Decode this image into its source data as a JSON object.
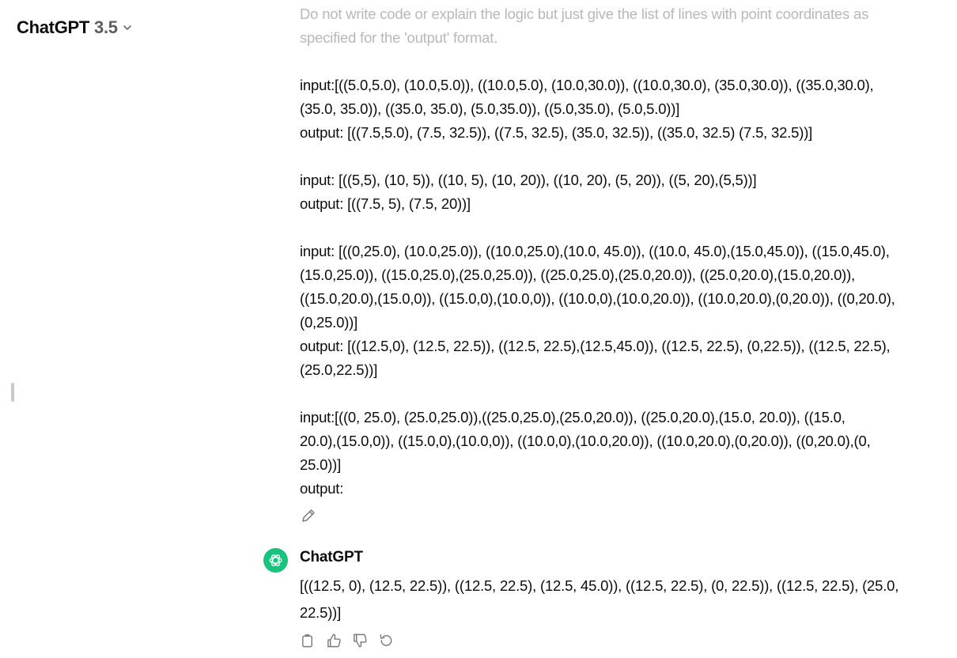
{
  "header": {
    "model_name": "ChatGPT",
    "model_version": "3.5",
    "chevron_icon": "chevron-down-icon"
  },
  "conversation": {
    "user_message": {
      "intro": "Do not write code or explain the logic but just give the list of lines with point coordinates as specified for the 'output' format.",
      "examples": [
        {
          "input_lines": [
            "input:[((5.0,5.0), (10.0,5.0)), ((10.0,5.0), (10.0,30.0)), ((10.0,30.0), (35.0,30.0)), ((35.0,30.0),",
            "(35.0, 35.0)), ((35.0, 35.0), (5.0,35.0)), ((5.0,35.0), (5.0,5.0))]"
          ],
          "output_lines": [
            "output: [((7.5,5.0), (7.5, 32.5)), ((7.5, 32.5), (35.0, 32.5)), ((35.0, 32.5) (7.5, 32.5))]"
          ]
        },
        {
          "input_lines": [
            "input: [((5,5), (10, 5)), ((10, 5), (10, 20)), ((10, 20), (5, 20)), ((5, 20),(5,5))]"
          ],
          "output_lines": [
            "output: [((7.5, 5), (7.5, 20))]"
          ]
        },
        {
          "input_lines": [
            "input: [((0,25.0), (10.0,25.0)), ((10.0,25.0),(10.0, 45.0)), ((10.0, 45.0),(15.0,45.0)), ((15.0,45.0),",
            "(15.0,25.0)), ((15.0,25.0),(25.0,25.0)), ((25.0,25.0),(25.0,20.0)), ((25.0,20.0),(15.0,20.0)),",
            "((15.0,20.0),(15.0,0)), ((15.0,0),(10.0,0)), ((10.0,0),(10.0,20.0)), ((10.0,20.0),(0,20.0)), ((0,20.0),",
            "(0,25.0))]"
          ],
          "output_lines": [
            "output: [((12.5,0), (12.5, 22.5)), ((12.5, 22.5),(12.5,45.0)), ((12.5, 22.5), (0,22.5)), ((12.5, 22.5),",
            "(25.0,22.5))]"
          ]
        },
        {
          "input_lines": [
            "input:[((0, 25.0), (25.0,25.0)),((25.0,25.0),(25.0,20.0)), ((25.0,20.0),(15.0, 20.0)), ((15.0,",
            "20.0),(15.0,0)), ((15.0,0),(10.0,0)), ((10.0,0),(10.0,20.0)), ((10.0,20.0),(0,20.0)), ((0,20.0),(0,",
            "25.0))]"
          ],
          "output_lines": [
            "output:"
          ]
        }
      ],
      "edit_icon": "pencil-icon"
    },
    "assistant_message": {
      "name": "ChatGPT",
      "avatar_icon": "openai-logo-icon",
      "avatar_color": "#19c37d",
      "answer_lines": [
        "[((12.5, 0), (12.5, 22.5)), ((12.5, 22.5), (12.5, 45.0)), ((12.5, 22.5), (0, 22.5)), ((12.5, 22.5), (25.0,",
        "22.5))]"
      ],
      "actions": [
        "copy-icon",
        "thumbs-up-icon",
        "thumbs-down-icon",
        "regenerate-icon"
      ]
    }
  }
}
